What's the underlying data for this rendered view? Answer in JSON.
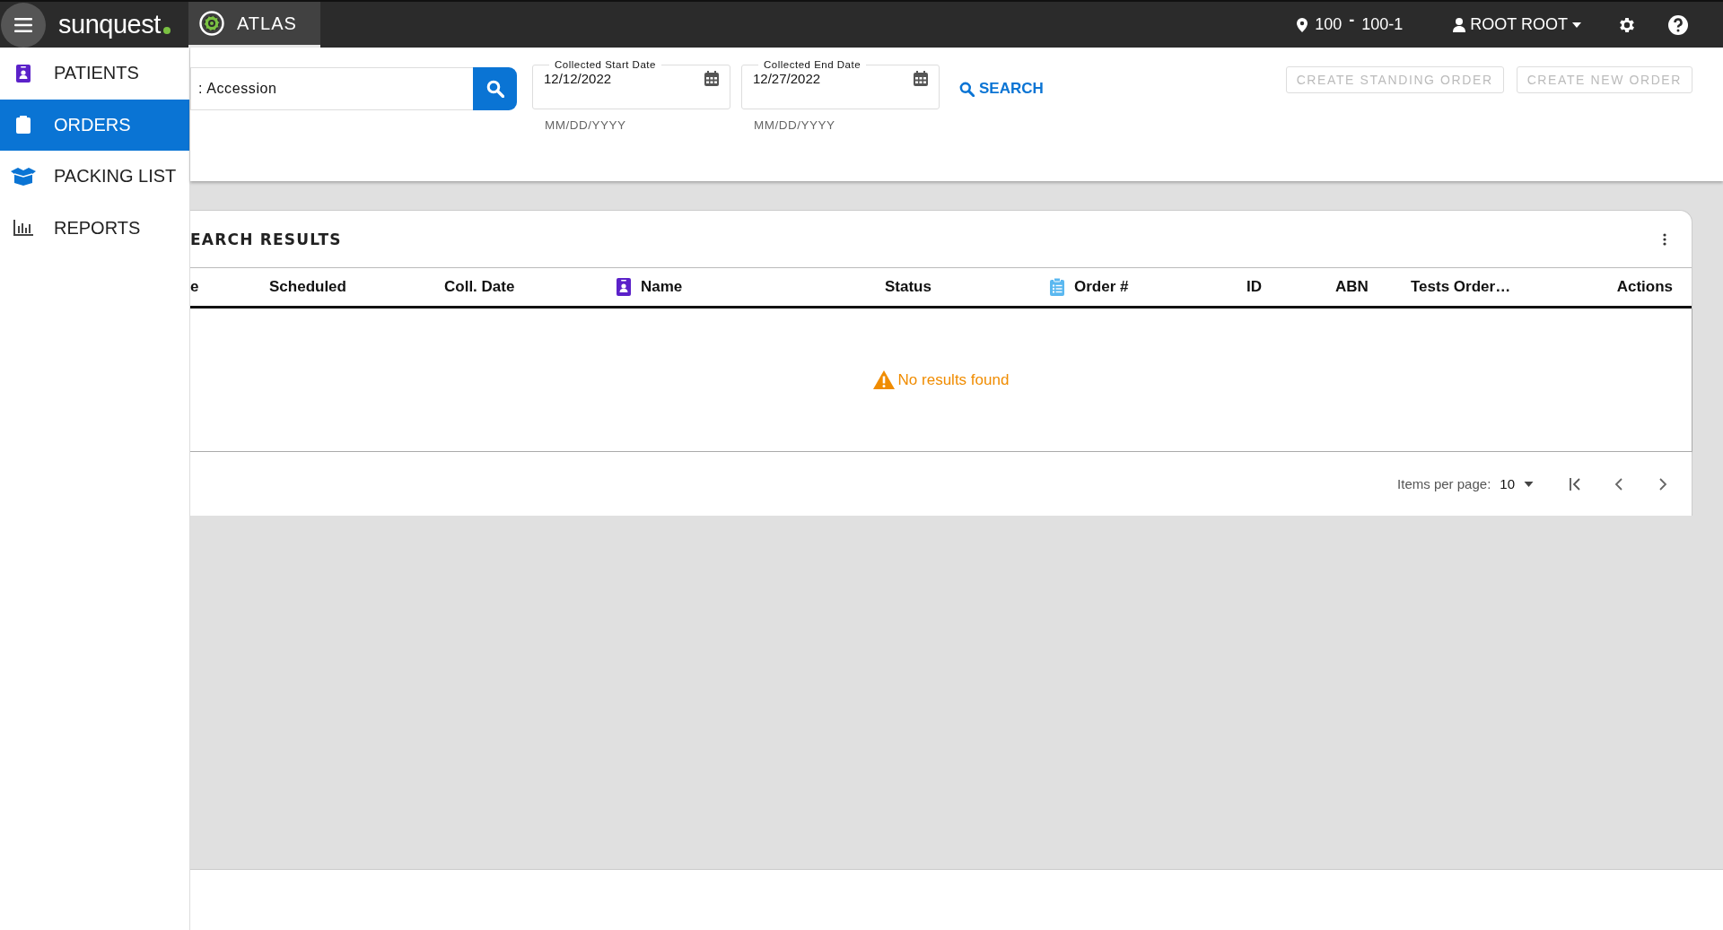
{
  "header": {
    "brand": "**sun**quest",
    "app_tab": {
      "label": "ATLAS",
      "selected": true
    },
    "location": {
      "site": "100",
      "separator": "-",
      "unit": "100-1"
    },
    "user": "ROOT ROOT"
  },
  "sidebar": {
    "items": [
      {
        "label": "PATIENTS",
        "kind": "patient",
        "selected": false
      },
      {
        "label": "ORDERS",
        "kind": "clipboard",
        "selected": true
      },
      {
        "label": "PACKING LIST",
        "kind": "box",
        "selected": false
      },
      {
        "label": "REPORTS",
        "kind": "chart",
        "selected": false
      }
    ]
  },
  "filters": {
    "search_field": {
      "value": ": Accession"
    },
    "dates": [
      {
        "label": "Collected Start Date",
        "value": "12/12/2022",
        "hint": "MM/DD/YYYY"
      },
      {
        "label": "Collected End Date",
        "value": "12/27/2022",
        "hint": "MM/DD/YYYY"
      }
    ],
    "search_link": "SEARCH",
    "buttons": [
      {
        "label": "CREATE STANDING ORDER",
        "disabled": true
      },
      {
        "label": "CREATE NEW ORDER",
        "disabled": true
      }
    ]
  },
  "results": {
    "title": "EARCH RESULTS",
    "columns": [
      {
        "label": "e"
      },
      {
        "label": "Scheduled"
      },
      {
        "label": "Coll. Date"
      },
      {
        "label": "Name",
        "kind": "patient"
      },
      {
        "label": "Status"
      },
      {
        "label": "Order #",
        "kind": "clipboard"
      },
      {
        "label": "ID"
      },
      {
        "label": "ABN"
      },
      {
        "label": "Tests Order…"
      },
      {
        "label": "Actions"
      }
    ],
    "empty_message": "No results found",
    "pagination": {
      "label": "Items per page:",
      "value": "10"
    }
  }
}
